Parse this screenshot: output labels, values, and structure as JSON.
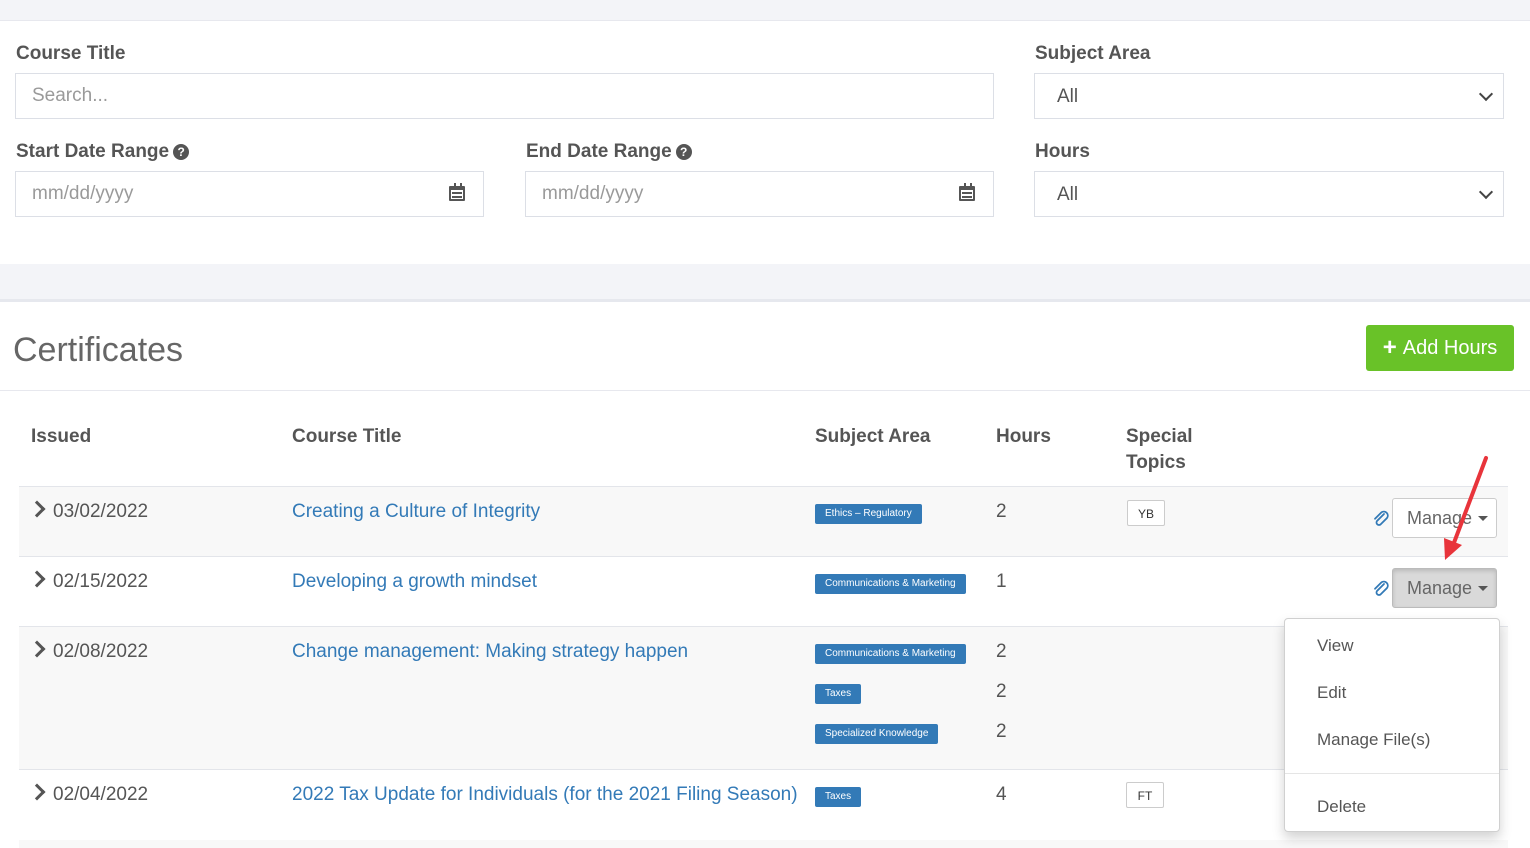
{
  "filters": {
    "course_title": {
      "label": "Course Title",
      "placeholder": "Search..."
    },
    "subject_area": {
      "label": "Subject Area",
      "value": "All"
    },
    "start_date": {
      "label": "Start Date Range",
      "placeholder": "mm/dd/yyyy"
    },
    "end_date": {
      "label": "End Date Range",
      "placeholder": "mm/dd/yyyy"
    },
    "hours": {
      "label": "Hours",
      "value": "All"
    }
  },
  "certificates": {
    "title": "Certificates",
    "add_label": "Add Hours",
    "columns": {
      "issued": "Issued",
      "course_title": "Course Title",
      "subject_area": "Subject Area",
      "hours": "Hours",
      "special_line1": "Special",
      "special_line2": "Topics"
    },
    "rows": [
      {
        "issued": "03/02/2022",
        "title": "Creating a Culture of Integrity",
        "subjects": [
          "Ethics – Regulatory"
        ],
        "hours": [
          "2"
        ],
        "topic": "YB",
        "manage": "Manage"
      },
      {
        "issued": "02/15/2022",
        "title": "Developing a growth mindset",
        "subjects": [
          "Communications & Marketing"
        ],
        "hours": [
          "1"
        ],
        "topic": "",
        "manage": "Manage"
      },
      {
        "issued": "02/08/2022",
        "title": "Change management: Making strategy happen",
        "subjects": [
          "Communications & Marketing",
          "Taxes",
          "Specialized Knowledge"
        ],
        "hours": [
          "2",
          "2",
          "2"
        ],
        "topic": ""
      },
      {
        "issued": "02/04/2022",
        "title": "2022 Tax Update for Individuals (for the 2021 Filing Season)",
        "subjects": [
          "Taxes"
        ],
        "hours": [
          "4"
        ],
        "topic": "FT"
      }
    ]
  },
  "dropdown_menu": {
    "items": [
      "View",
      "Edit",
      "Manage File(s)"
    ],
    "danger_item": "Delete"
  },
  "colors": {
    "accent": "#337ab7",
    "add_button": "#69c228",
    "annotation_arrow": "#e8343b"
  }
}
